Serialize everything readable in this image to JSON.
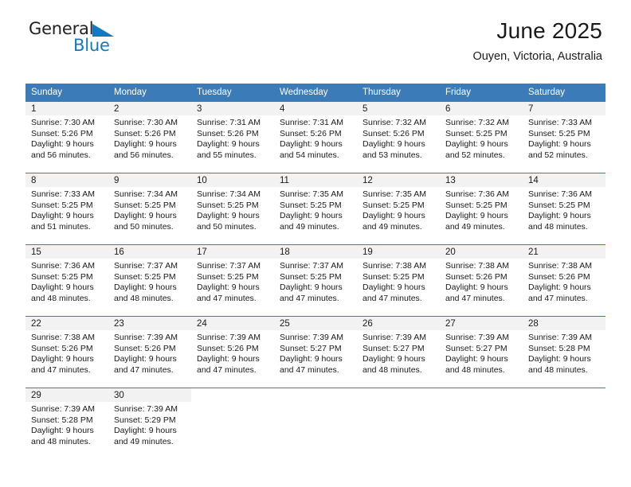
{
  "brand": {
    "name_top": "General",
    "name_bottom": "Blue",
    "triangle_icon": "blue-triangle-icon",
    "accent_color": "#1679c0"
  },
  "header": {
    "title": "June 2025",
    "subtitle": "Ouyen, Victoria, Australia"
  },
  "theme": {
    "header_row_bg": "#3b7cb8",
    "daynum_band_bg": "#f2f2f2",
    "grid_line": "#3b7cb8",
    "text": "#1a1a1a"
  },
  "weekday_headers": [
    "Sunday",
    "Monday",
    "Tuesday",
    "Wednesday",
    "Thursday",
    "Friday",
    "Saturday"
  ],
  "weeks": [
    [
      {
        "day": "1",
        "sunrise": "Sunrise: 7:30 AM",
        "sunset": "Sunset: 5:26 PM",
        "daylight_line1": "Daylight: 9 hours",
        "daylight_line2": "and 56 minutes."
      },
      {
        "day": "2",
        "sunrise": "Sunrise: 7:30 AM",
        "sunset": "Sunset: 5:26 PM",
        "daylight_line1": "Daylight: 9 hours",
        "daylight_line2": "and 56 minutes."
      },
      {
        "day": "3",
        "sunrise": "Sunrise: 7:31 AM",
        "sunset": "Sunset: 5:26 PM",
        "daylight_line1": "Daylight: 9 hours",
        "daylight_line2": "and 55 minutes."
      },
      {
        "day": "4",
        "sunrise": "Sunrise: 7:31 AM",
        "sunset": "Sunset: 5:26 PM",
        "daylight_line1": "Daylight: 9 hours",
        "daylight_line2": "and 54 minutes."
      },
      {
        "day": "5",
        "sunrise": "Sunrise: 7:32 AM",
        "sunset": "Sunset: 5:26 PM",
        "daylight_line1": "Daylight: 9 hours",
        "daylight_line2": "and 53 minutes."
      },
      {
        "day": "6",
        "sunrise": "Sunrise: 7:32 AM",
        "sunset": "Sunset: 5:25 PM",
        "daylight_line1": "Daylight: 9 hours",
        "daylight_line2": "and 52 minutes."
      },
      {
        "day": "7",
        "sunrise": "Sunrise: 7:33 AM",
        "sunset": "Sunset: 5:25 PM",
        "daylight_line1": "Daylight: 9 hours",
        "daylight_line2": "and 52 minutes."
      }
    ],
    [
      {
        "day": "8",
        "sunrise": "Sunrise: 7:33 AM",
        "sunset": "Sunset: 5:25 PM",
        "daylight_line1": "Daylight: 9 hours",
        "daylight_line2": "and 51 minutes."
      },
      {
        "day": "9",
        "sunrise": "Sunrise: 7:34 AM",
        "sunset": "Sunset: 5:25 PM",
        "daylight_line1": "Daylight: 9 hours",
        "daylight_line2": "and 50 minutes."
      },
      {
        "day": "10",
        "sunrise": "Sunrise: 7:34 AM",
        "sunset": "Sunset: 5:25 PM",
        "daylight_line1": "Daylight: 9 hours",
        "daylight_line2": "and 50 minutes."
      },
      {
        "day": "11",
        "sunrise": "Sunrise: 7:35 AM",
        "sunset": "Sunset: 5:25 PM",
        "daylight_line1": "Daylight: 9 hours",
        "daylight_line2": "and 49 minutes."
      },
      {
        "day": "12",
        "sunrise": "Sunrise: 7:35 AM",
        "sunset": "Sunset: 5:25 PM",
        "daylight_line1": "Daylight: 9 hours",
        "daylight_line2": "and 49 minutes."
      },
      {
        "day": "13",
        "sunrise": "Sunrise: 7:36 AM",
        "sunset": "Sunset: 5:25 PM",
        "daylight_line1": "Daylight: 9 hours",
        "daylight_line2": "and 49 minutes."
      },
      {
        "day": "14",
        "sunrise": "Sunrise: 7:36 AM",
        "sunset": "Sunset: 5:25 PM",
        "daylight_line1": "Daylight: 9 hours",
        "daylight_line2": "and 48 minutes."
      }
    ],
    [
      {
        "day": "15",
        "sunrise": "Sunrise: 7:36 AM",
        "sunset": "Sunset: 5:25 PM",
        "daylight_line1": "Daylight: 9 hours",
        "daylight_line2": "and 48 minutes."
      },
      {
        "day": "16",
        "sunrise": "Sunrise: 7:37 AM",
        "sunset": "Sunset: 5:25 PM",
        "daylight_line1": "Daylight: 9 hours",
        "daylight_line2": "and 48 minutes."
      },
      {
        "day": "17",
        "sunrise": "Sunrise: 7:37 AM",
        "sunset": "Sunset: 5:25 PM",
        "daylight_line1": "Daylight: 9 hours",
        "daylight_line2": "and 47 minutes."
      },
      {
        "day": "18",
        "sunrise": "Sunrise: 7:37 AM",
        "sunset": "Sunset: 5:25 PM",
        "daylight_line1": "Daylight: 9 hours",
        "daylight_line2": "and 47 minutes."
      },
      {
        "day": "19",
        "sunrise": "Sunrise: 7:38 AM",
        "sunset": "Sunset: 5:25 PM",
        "daylight_line1": "Daylight: 9 hours",
        "daylight_line2": "and 47 minutes."
      },
      {
        "day": "20",
        "sunrise": "Sunrise: 7:38 AM",
        "sunset": "Sunset: 5:26 PM",
        "daylight_line1": "Daylight: 9 hours",
        "daylight_line2": "and 47 minutes."
      },
      {
        "day": "21",
        "sunrise": "Sunrise: 7:38 AM",
        "sunset": "Sunset: 5:26 PM",
        "daylight_line1": "Daylight: 9 hours",
        "daylight_line2": "and 47 minutes."
      }
    ],
    [
      {
        "day": "22",
        "sunrise": "Sunrise: 7:38 AM",
        "sunset": "Sunset: 5:26 PM",
        "daylight_line1": "Daylight: 9 hours",
        "daylight_line2": "and 47 minutes."
      },
      {
        "day": "23",
        "sunrise": "Sunrise: 7:39 AM",
        "sunset": "Sunset: 5:26 PM",
        "daylight_line1": "Daylight: 9 hours",
        "daylight_line2": "and 47 minutes."
      },
      {
        "day": "24",
        "sunrise": "Sunrise: 7:39 AM",
        "sunset": "Sunset: 5:26 PM",
        "daylight_line1": "Daylight: 9 hours",
        "daylight_line2": "and 47 minutes."
      },
      {
        "day": "25",
        "sunrise": "Sunrise: 7:39 AM",
        "sunset": "Sunset: 5:27 PM",
        "daylight_line1": "Daylight: 9 hours",
        "daylight_line2": "and 47 minutes."
      },
      {
        "day": "26",
        "sunrise": "Sunrise: 7:39 AM",
        "sunset": "Sunset: 5:27 PM",
        "daylight_line1": "Daylight: 9 hours",
        "daylight_line2": "and 48 minutes."
      },
      {
        "day": "27",
        "sunrise": "Sunrise: 7:39 AM",
        "sunset": "Sunset: 5:27 PM",
        "daylight_line1": "Daylight: 9 hours",
        "daylight_line2": "and 48 minutes."
      },
      {
        "day": "28",
        "sunrise": "Sunrise: 7:39 AM",
        "sunset": "Sunset: 5:28 PM",
        "daylight_line1": "Daylight: 9 hours",
        "daylight_line2": "and 48 minutes."
      }
    ],
    [
      {
        "day": "29",
        "sunrise": "Sunrise: 7:39 AM",
        "sunset": "Sunset: 5:28 PM",
        "daylight_line1": "Daylight: 9 hours",
        "daylight_line2": "and 48 minutes."
      },
      {
        "day": "30",
        "sunrise": "Sunrise: 7:39 AM",
        "sunset": "Sunset: 5:29 PM",
        "daylight_line1": "Daylight: 9 hours",
        "daylight_line2": "and 49 minutes."
      },
      {
        "day": "",
        "sunrise": "",
        "sunset": "",
        "daylight_line1": "",
        "daylight_line2": ""
      },
      {
        "day": "",
        "sunrise": "",
        "sunset": "",
        "daylight_line1": "",
        "daylight_line2": ""
      },
      {
        "day": "",
        "sunrise": "",
        "sunset": "",
        "daylight_line1": "",
        "daylight_line2": ""
      },
      {
        "day": "",
        "sunrise": "",
        "sunset": "",
        "daylight_line1": "",
        "daylight_line2": ""
      },
      {
        "day": "",
        "sunrise": "",
        "sunset": "",
        "daylight_line1": "",
        "daylight_line2": ""
      }
    ]
  ]
}
